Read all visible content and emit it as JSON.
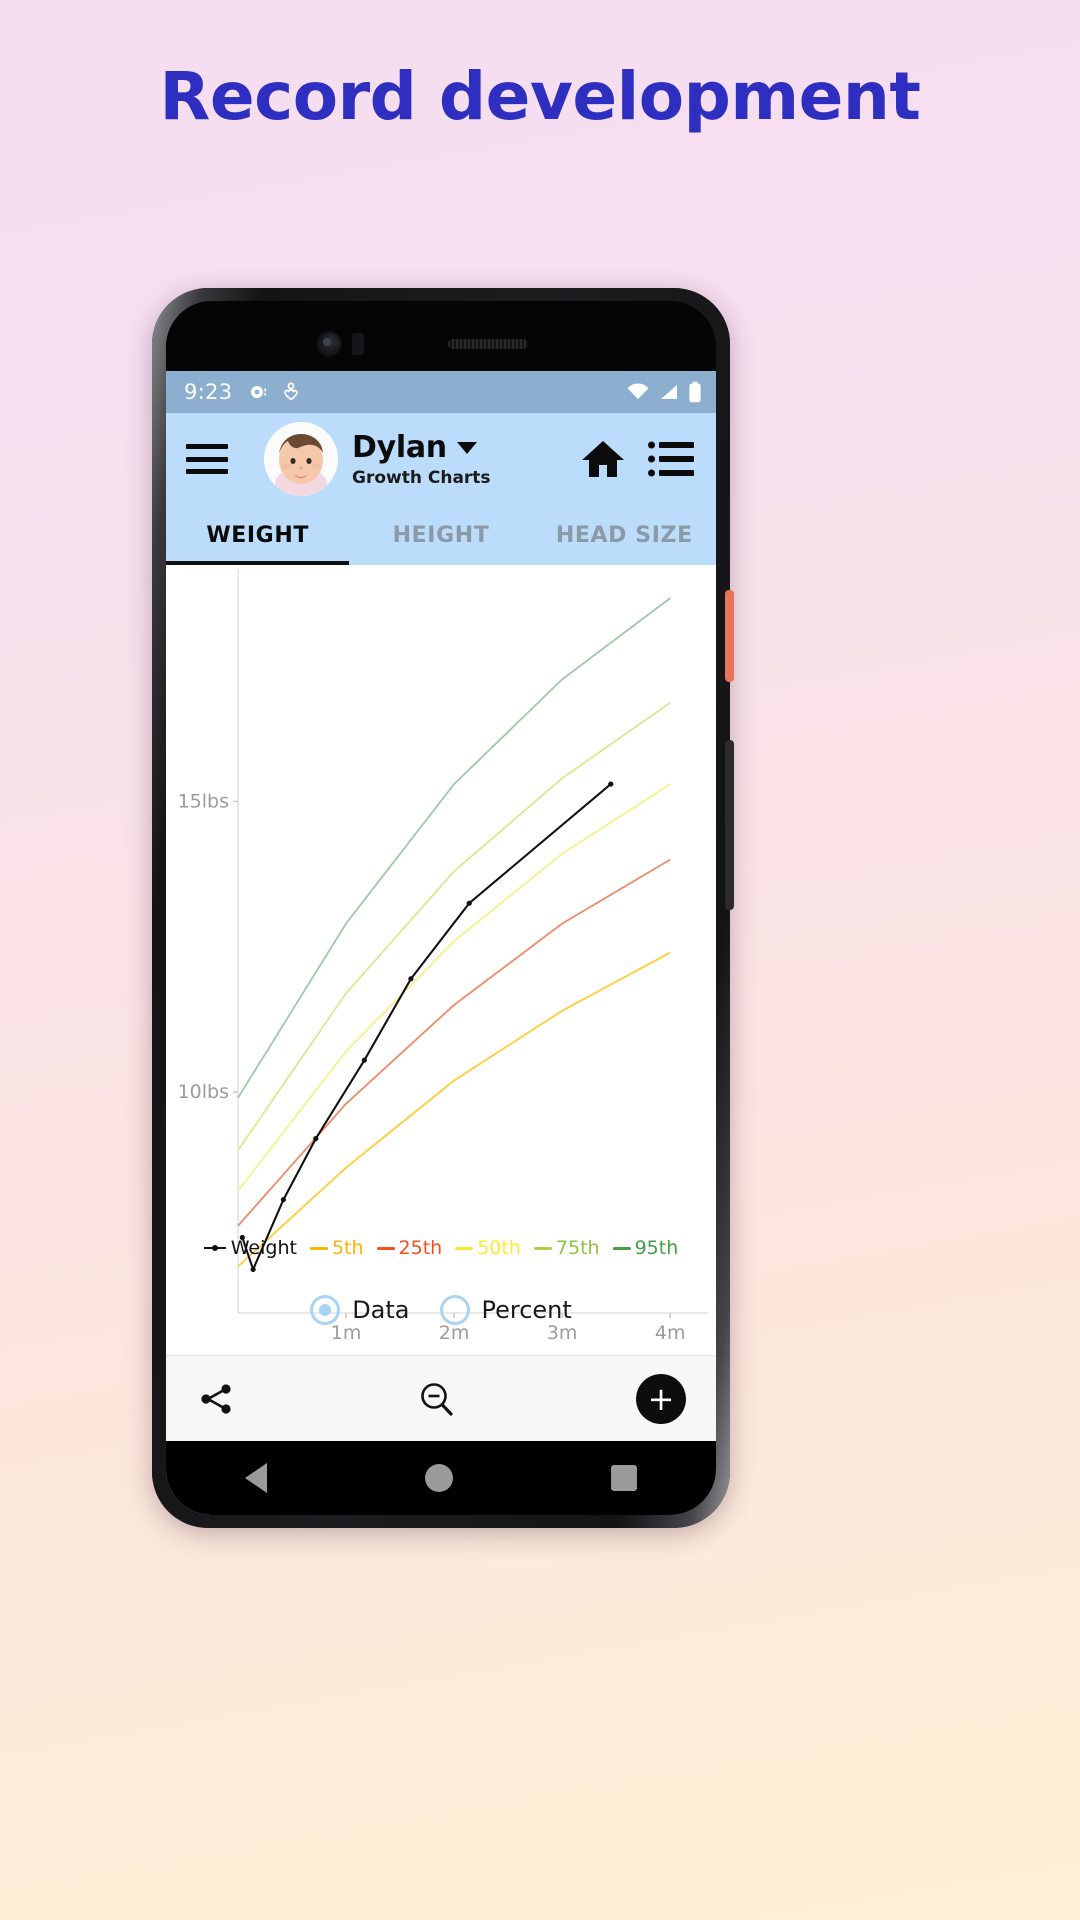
{
  "promo": {
    "headline": "Record development",
    "background_top": "#f6ddf2",
    "background_bottom": "#fdf0d6",
    "headline_color": "#2e2ec0"
  },
  "phone": {
    "accent_power_button": "#e8745a"
  },
  "statusbar": {
    "time": "9:23",
    "left_icons": [
      "camera-record-icon",
      "heart-person-icon"
    ],
    "right_icons": [
      "wifi-icon",
      "cellular-signal-icon",
      "battery-icon"
    ],
    "background": "#8cafd0"
  },
  "appbar": {
    "menu_icon": "hamburger-menu-icon",
    "avatar": "baby-photo-avatar",
    "title": "Dylan",
    "subtitle": "Growth Charts",
    "dropdown_icon": "chevron-down-icon",
    "actions": [
      "home-icon",
      "list-icon"
    ],
    "background": "#bcdcfb"
  },
  "tabs": {
    "items": [
      {
        "label": "WEIGHT",
        "active": true
      },
      {
        "label": "HEIGHT",
        "active": false
      },
      {
        "label": "HEAD SIZE",
        "active": false
      }
    ],
    "active_index": 0,
    "active_color": "#0a0a0a",
    "inactive_color": "#8c9aa8"
  },
  "legend": {
    "measure_label": "Weight",
    "measure_color": "#111111",
    "percentiles": [
      {
        "label": "5th",
        "color": "#ffb300"
      },
      {
        "label": "25th",
        "color": "#f4511e"
      },
      {
        "label": "50th",
        "color": "#ffeb3b"
      },
      {
        "label": "75th",
        "color": "#aed146"
      },
      {
        "label": "95th",
        "color": "#43a047"
      }
    ]
  },
  "mode_selector": {
    "options": [
      {
        "label": "Data",
        "selected": true
      },
      {
        "label": "Percent",
        "selected": false
      }
    ],
    "accent": "#a9d3f5"
  },
  "bottombar": {
    "share_icon": "share-icon",
    "zoom_out_icon": "zoom-out-icon",
    "add_label": "+",
    "add_icon": "add-icon"
  },
  "navbar": {
    "back_icon": "back-triangle-icon",
    "home_icon": "home-circle-icon",
    "recents_icon": "recents-square-icon"
  },
  "chart_data": {
    "type": "line",
    "title": "Weight growth chart",
    "xlabel": "",
    "ylabel": "",
    "x_ticks": [
      "1m",
      "2m",
      "3m",
      "4m"
    ],
    "y_ticks": [
      "10lbs",
      "15lbs"
    ],
    "xlim": [
      0,
      4.35
    ],
    "ylim": [
      6.2,
      19.0
    ],
    "grid": false,
    "legend_position": "bottom",
    "series": [
      {
        "name": "Weight",
        "color": "#111111",
        "type": "measured",
        "points": [
          {
            "x": 0.04,
            "y": 7.5
          },
          {
            "x": 0.14,
            "y": 6.95
          },
          {
            "x": 0.42,
            "y": 8.15
          },
          {
            "x": 0.72,
            "y": 9.2
          },
          {
            "x": 1.17,
            "y": 10.55
          },
          {
            "x": 1.6,
            "y": 11.95
          },
          {
            "x": 2.14,
            "y": 13.25
          },
          {
            "x": 3.45,
            "y": 15.3
          }
        ]
      },
      {
        "name": "5th",
        "color": "#ffcd38",
        "points": [
          {
            "x": 0.0,
            "y": 7.0
          },
          {
            "x": 1.0,
            "y": 8.7
          },
          {
            "x": 2.0,
            "y": 10.2
          },
          {
            "x": 3.0,
            "y": 11.4
          },
          {
            "x": 4.0,
            "y": 12.4
          }
        ]
      },
      {
        "name": "25th",
        "color": "#f08a6a",
        "points": [
          {
            "x": 0.0,
            "y": 7.7
          },
          {
            "x": 1.0,
            "y": 9.8
          },
          {
            "x": 2.0,
            "y": 11.5
          },
          {
            "x": 3.0,
            "y": 12.9
          },
          {
            "x": 4.0,
            "y": 14.0
          }
        ]
      },
      {
        "name": "50th",
        "color": "#f5f08a",
        "points": [
          {
            "x": 0.0,
            "y": 8.3
          },
          {
            "x": 1.0,
            "y": 10.7
          },
          {
            "x": 2.0,
            "y": 12.6
          },
          {
            "x": 3.0,
            "y": 14.1
          },
          {
            "x": 4.0,
            "y": 15.3
          }
        ]
      },
      {
        "name": "75th",
        "color": "#d8e98d",
        "points": [
          {
            "x": 0.0,
            "y": 9.0
          },
          {
            "x": 1.0,
            "y": 11.7
          },
          {
            "x": 2.0,
            "y": 13.8
          },
          {
            "x": 3.0,
            "y": 15.4
          },
          {
            "x": 4.0,
            "y": 16.7
          }
        ]
      },
      {
        "name": "95th",
        "color": "#9ec9a8",
        "points": [
          {
            "x": 0.0,
            "y": 9.9
          },
          {
            "x": 1.0,
            "y": 12.9
          },
          {
            "x": 2.0,
            "y": 15.3
          },
          {
            "x": 3.0,
            "y": 17.1
          },
          {
            "x": 4.0,
            "y": 18.5
          }
        ]
      }
    ]
  }
}
